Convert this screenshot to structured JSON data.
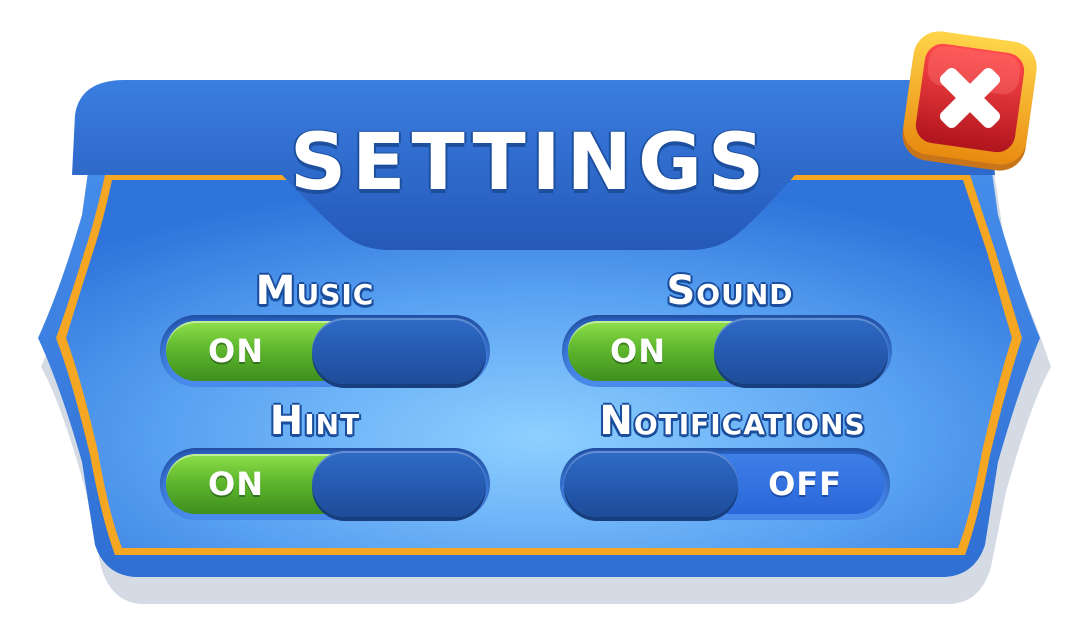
{
  "title": "SETTINGS",
  "colors": {
    "panel_light": "#7fbaf7",
    "panel_dark": "#2f73d6",
    "header": "#2b69c9",
    "border_orange": "#f5a623",
    "toggle_on": "#5fb82e",
    "close_red": "#d9232b",
    "close_frame": "#f7b21c"
  },
  "toggles": [
    {
      "label": "Music",
      "state": "ON"
    },
    {
      "label": "Sound",
      "state": "ON"
    },
    {
      "label": "Hint",
      "state": "ON"
    },
    {
      "label": "Notifications",
      "state": "OFF"
    }
  ],
  "close_button": {
    "icon": "close-x-icon"
  }
}
